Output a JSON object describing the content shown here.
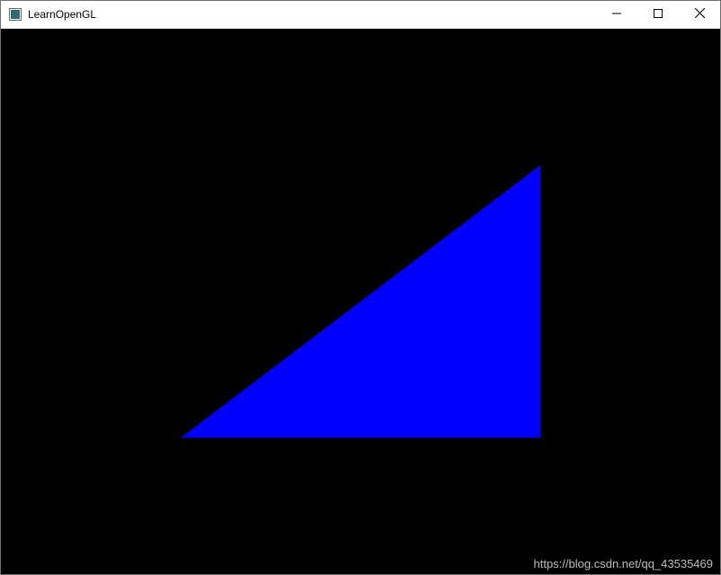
{
  "window": {
    "title": "LearnOpenGL",
    "icon_name": "app-icon"
  },
  "controls": {
    "minimize": "Minimize",
    "maximize": "Maximize",
    "close": "Close"
  },
  "canvas": {
    "clear_color": "#000000",
    "triangle": {
      "fill": "#0000ff",
      "vertices_ndc": [
        [
          -0.5,
          -0.5
        ],
        [
          0.5,
          -0.5
        ],
        [
          0.5,
          0.5
        ]
      ]
    }
  },
  "watermark": {
    "text": "https://blog.csdn.net/qq_43535469"
  }
}
